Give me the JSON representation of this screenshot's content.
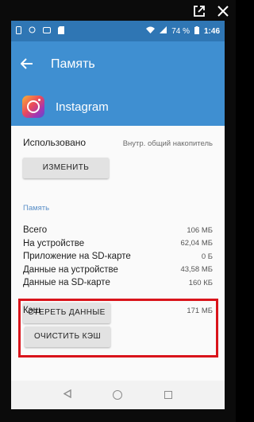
{
  "status_bar": {
    "battery": "74 %",
    "time": "1:46"
  },
  "app_bar": {
    "title": "Память"
  },
  "app": {
    "name": "Instagram"
  },
  "storage": {
    "used_label": "Использовано",
    "used_value": "Внутр. общий накопитель",
    "change_button": "ИЗМЕНИТЬ"
  },
  "memory_section": {
    "title": "Память",
    "rows": [
      {
        "label": "Всего",
        "value": "106 МБ"
      },
      {
        "label": "На устройстве",
        "value": "62,04 МБ"
      },
      {
        "label": "Приложение на SD-карте",
        "value": "0 Б"
      },
      {
        "label": "Данные на устройстве",
        "value": "43,58 МБ"
      },
      {
        "label": "Данные на SD-карте",
        "value": "160 КБ"
      }
    ],
    "clear_data_button": "СТЕРЕТЬ ДАННЫЕ"
  },
  "cache": {
    "label": "Кэш",
    "value": "171 МБ",
    "clear_cache_button": "ОЧИСТИТЬ КЭШ"
  },
  "colors": {
    "app_bar": "#3f8fd1",
    "status_bar": "#2f76b4",
    "highlight": "#d9141b"
  }
}
